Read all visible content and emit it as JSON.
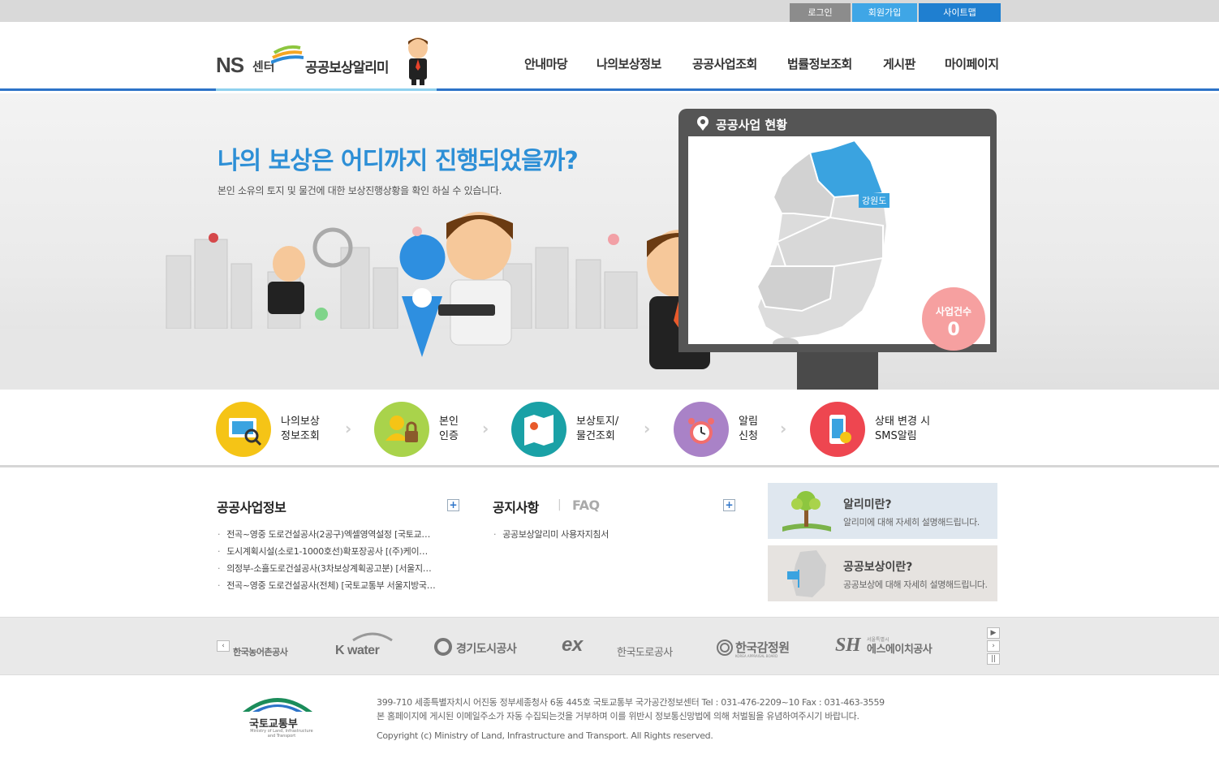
{
  "util": {
    "login": "로그인",
    "join": "회원가입",
    "sitemap": "사이트맵"
  },
  "logo": {
    "ns": "NS",
    "center": "센터",
    "name": "공공보상알리미"
  },
  "gnb": [
    "안내마당",
    "나의보상정보",
    "공공사업조회",
    "법률정보조회",
    "게시판",
    "마이페이지"
  ],
  "hero": {
    "title": "나의 보상은 어디까지 진행되었을까?",
    "subtitle": "본인 소유의 토지 및 물건에 대한 보상진행상황을 확인 하실 수 있습니다.",
    "monitor_title": "공공사업 현황",
    "region": "강원도",
    "badge_label": "사업건수",
    "badge_count": "0"
  },
  "quick": [
    {
      "l1": "나의보상",
      "l2": "정보조회",
      "color": "#f5c416"
    },
    {
      "l1": "본인",
      "l2": "인증",
      "color": "#a9d34b"
    },
    {
      "l1": "보상토지/",
      "l2": "물건조회",
      "color": "#1aa1a6"
    },
    {
      "l1": "알림",
      "l2": "신청",
      "color": "#a982c7"
    },
    {
      "l1": "상태 변경 시",
      "l2": "SMS알림",
      "color": "#ee4650"
    }
  ],
  "public_info": {
    "title": "공공사업정보",
    "items": [
      "전곡~영중 도로건설공사(2공구)엑셀영역설정 [국토교…",
      "도시계획시설(소로1-1000호선)확포장공사 [(주)케이…",
      "의정부-소흘도로건설공사(3차보상계획공고분) [서울지…",
      "전곡~영중 도로건설공사(전체) [국토교통부 서울지방국…"
    ]
  },
  "notice": {
    "tab1": "공지사항",
    "tab2": "FAQ",
    "items": [
      "공공보상알리미 사용자지침서"
    ]
  },
  "side": [
    {
      "title": "알리미란?",
      "desc": "알리미에 대해 자세히 설명해드립니다."
    },
    {
      "title": "공공보상이란?",
      "desc": "공공보상에 대해 자세히 설명해드립니다."
    }
  ],
  "partners": [
    "한국농어촌공사",
    "K water",
    "경기도시공사",
    "한국도로공사",
    "한국감정원",
    "에스에이치공사"
  ],
  "partner_marks": {
    "ex": "ex",
    "sh": "SH",
    "sh_small": "서울특별시",
    "ka_small": "KOREA APPRAISAL BOARD"
  },
  "footer": {
    "address": "399-710 세종특별자치시 어진동 정부세종청사 6동 445호 국토교통부 국가공간정보센터 Tel : 031-476-2209~10 Fax : 031-463-3559",
    "notice": "본 홈페이지에 게시된 이메일주소가 자동 수집되는것을 거부하며 이를 위반시 정보통신망법에 의해 처벌됨을 유념하여주시기 바랍니다.",
    "copyright": "Copyright (c) Ministry of Land, Infrastructure and Transport. All Rights reserved.",
    "logo_ko": "국토교통부",
    "logo_en": "Ministry of Land, Infrastructure and Transport"
  }
}
